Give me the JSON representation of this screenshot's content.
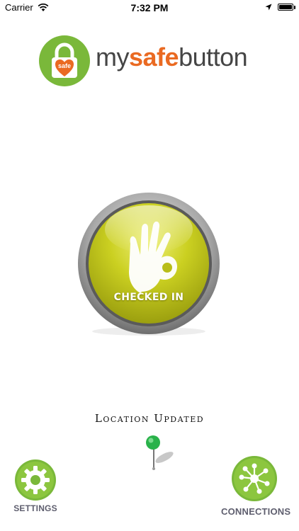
{
  "status_bar": {
    "carrier": "Carrier",
    "time": "7:32 PM",
    "icons": [
      "wifi-icon",
      "location-arrow-icon",
      "battery-icon"
    ]
  },
  "logo": {
    "badge_text": "safe",
    "text_prefix": "my",
    "text_highlight": "safe",
    "text_suffix": "button",
    "colors": {
      "green": "#7ab83a",
      "orange": "#ea6a22",
      "gray": "#454545"
    }
  },
  "check_button": {
    "label": "CHECKED IN",
    "icon": "ok-hand-icon",
    "color": "#c9ce1c"
  },
  "location": {
    "status": "Location Updated",
    "icon": "map-pin-icon"
  },
  "bottom_nav": {
    "settings_label": "SETTINGS",
    "connections_label": "CONNECTIONS",
    "settings_icon": "gear-icon",
    "connections_icon": "network-icon"
  }
}
